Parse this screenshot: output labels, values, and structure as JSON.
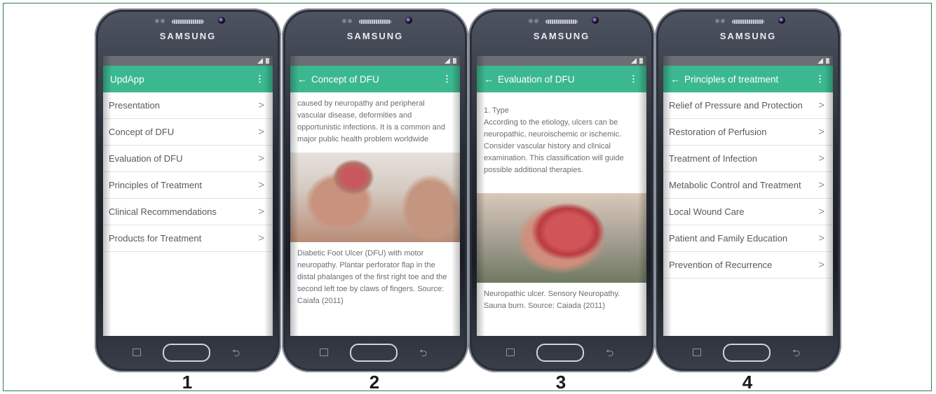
{
  "brand": "SAMSUNG",
  "phones": [
    {
      "number": "1",
      "title": "UpdApp",
      "items": [
        "Presentation",
        "Concept of DFU",
        "Evaluation of DFU",
        "Principles of Treatment",
        "Clinical Recommendations",
        "Products for Treatment"
      ]
    },
    {
      "number": "2",
      "title": "Concept of DFU",
      "text": "caused by neuropathy and peripheral vascular disease, deformities and opportunistic infections. It is a common and major public health problem worldwide",
      "caption": "Diabetic Foot Ulcer (DFU) with motor neuropathy. Plantar perforator flap in the distal phalanges of the first right toe and the second left toe by claws of fingers. Source: Caiafa (2011)"
    },
    {
      "number": "3",
      "title": "Evaluation of DFU",
      "text_heading": "1. Type",
      "text": "According to the etiology, ulcers can be neuropathic, neuroischemic or ischemic. Consider vascular history and clinical examination. This classification will guide possible additional therapies.",
      "caption": "Neuropathic ulcer. Sensory Neuropathy. Sauna burn. Source: Caiada (2011)"
    },
    {
      "number": "4",
      "title": "Principles of treatment",
      "items": [
        "Relief of Pressure and Protection",
        "Restoration of Perfusion",
        "Treatment of Infection",
        "Metabolic Control and Treatment",
        "Local Wound Care",
        "Patient and Family Education",
        "Prevention of Recurrence"
      ]
    }
  ],
  "icons": {
    "back": "←",
    "menu": "⋮",
    "chevron": ">",
    "nav_back": "⮌"
  },
  "colors": {
    "appbar": "#3bb88f",
    "frame_border": "#2f7a5a"
  }
}
